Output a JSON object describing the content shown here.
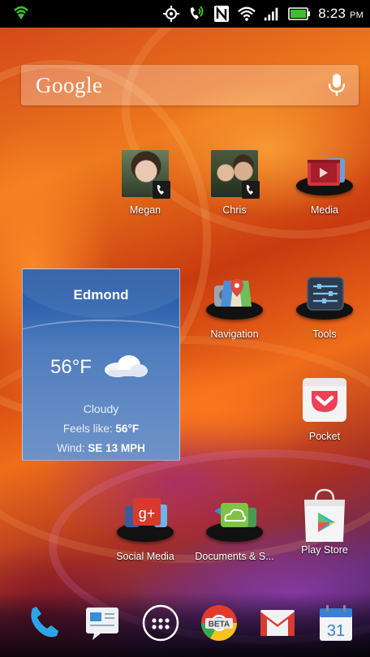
{
  "status_bar": {
    "time": "8:23",
    "ampm": "PM",
    "icons": [
      "notification-shield-icon",
      "location-crosshair-icon",
      "phone-speaker-icon",
      "nfc-icon",
      "wifi-icon",
      "cell-signal-icon",
      "battery-icon"
    ],
    "accent_green": "#3fbf2b"
  },
  "search": {
    "logo": "Google",
    "mic_icon": "microphone-icon"
  },
  "apps": {
    "megan": "Megan",
    "chris": "Chris",
    "media": "Media",
    "navigation": "Navigation",
    "tools": "Tools",
    "pocket": "Pocket",
    "social_media": "Social Media",
    "documents": "Documents & S...",
    "play_store": "Play Store"
  },
  "weather": {
    "city": "Edmond",
    "temperature": "56°F",
    "condition": "Cloudy",
    "feels_label": "Feels like: ",
    "feels_value": "56°F",
    "wind_label": "Wind: ",
    "wind_value": "SE 13 MPH",
    "background_color": "#3565ae"
  },
  "dock": {
    "items": [
      "phone-icon",
      "messaging-icon",
      "app-drawer-icon",
      "chrome-beta-icon",
      "gmail-icon",
      "calendar-icon"
    ],
    "chrome_badge": "BETA",
    "calendar_day": "31"
  }
}
